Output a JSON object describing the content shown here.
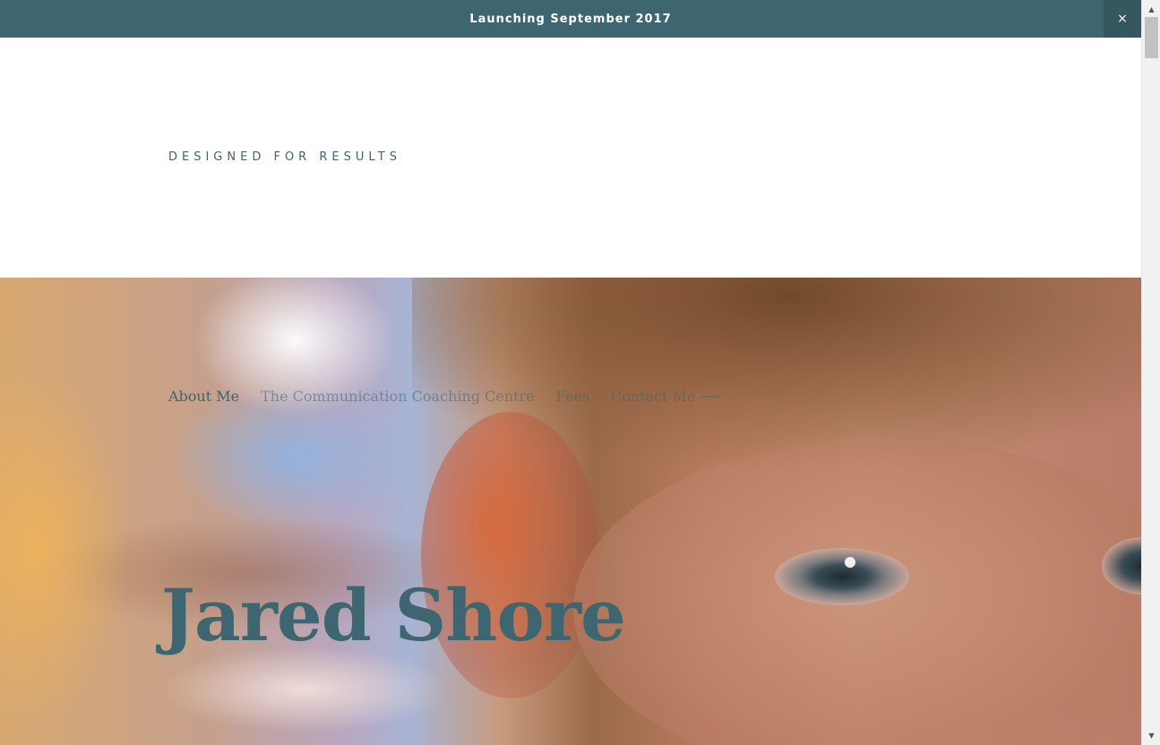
{
  "announcement": {
    "text": "Launching September 2017",
    "close_symbol": "×",
    "background": "#3d6670"
  },
  "header": {
    "tagline": "DESIGNED FOR RESULTS"
  },
  "nav": {
    "items": [
      {
        "label": "About Me",
        "active": true
      },
      {
        "label": "The Communication Coaching Centre",
        "active": false
      },
      {
        "label": "Fees",
        "active": false
      },
      {
        "label": "Contact Me ⟶",
        "active": false
      }
    ]
  },
  "hero": {
    "title": "Jared Shore",
    "image": "child-close-up-photo",
    "accent_color": "#3d6670"
  },
  "scrollbar": {
    "up_icon": "▲",
    "down_icon": "▼"
  }
}
